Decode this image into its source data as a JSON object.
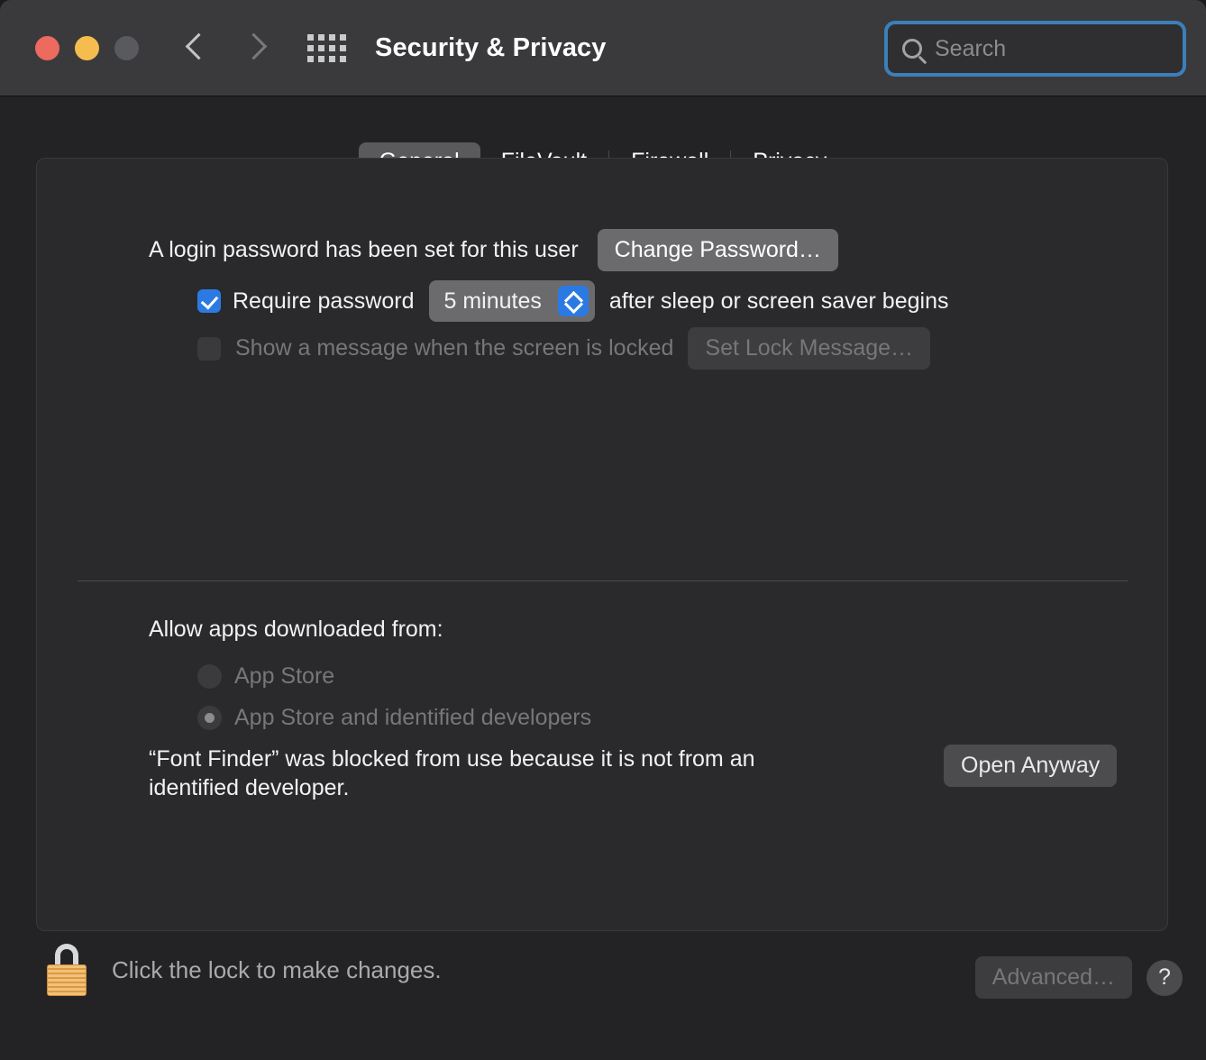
{
  "window": {
    "title": "Security & Privacy",
    "traffic_lights": [
      {
        "name": "close",
        "color": "#ec6a5e"
      },
      {
        "name": "minimize",
        "color": "#f5bd4f"
      },
      {
        "name": "zoom",
        "color": "#585a5d"
      }
    ],
    "nav": {
      "back_icon": "chevron-left-icon",
      "forward_icon": "chevron-right-icon",
      "grid_icon": "show-all-grid-icon"
    }
  },
  "search": {
    "placeholder": "Search",
    "value": "",
    "icon": "search-icon",
    "focus_ring_color": "#3c7fba"
  },
  "tabs": [
    {
      "label": "General",
      "active": true
    },
    {
      "label": "FileVault",
      "active": false
    },
    {
      "label": "Firewall",
      "active": false
    },
    {
      "label": "Privacy",
      "active": false
    }
  ],
  "general": {
    "login_password_text": "A login password has been set for this user",
    "change_password_label": "Change Password…",
    "require_password": {
      "checked": true,
      "label": "Require password",
      "delay_value": "5 minutes",
      "suffix": "after sleep or screen saver begins",
      "stepper_icon": "chevron-up-down-icon",
      "accent_color": "#2b7ae4"
    },
    "show_message": {
      "checked": false,
      "enabled": false,
      "label": "Show a message when the screen is locked",
      "button_label": "Set Lock Message…"
    },
    "allow_apps": {
      "title": "Allow apps downloaded from:",
      "enabled": false,
      "options": [
        {
          "label": "App Store",
          "selected": false
        },
        {
          "label": "App Store and identified developers",
          "selected": true
        }
      ]
    },
    "blocked_notice": {
      "text": "“Font Finder” was blocked from use because it is not from an identified developer.",
      "button_label": "Open Anyway"
    }
  },
  "bottom_bar": {
    "lock_icon": "padlock-closed-icon",
    "lock_text": "Click the lock to make changes.",
    "advanced_label": "Advanced…",
    "advanced_enabled": false,
    "help_label": "?"
  }
}
